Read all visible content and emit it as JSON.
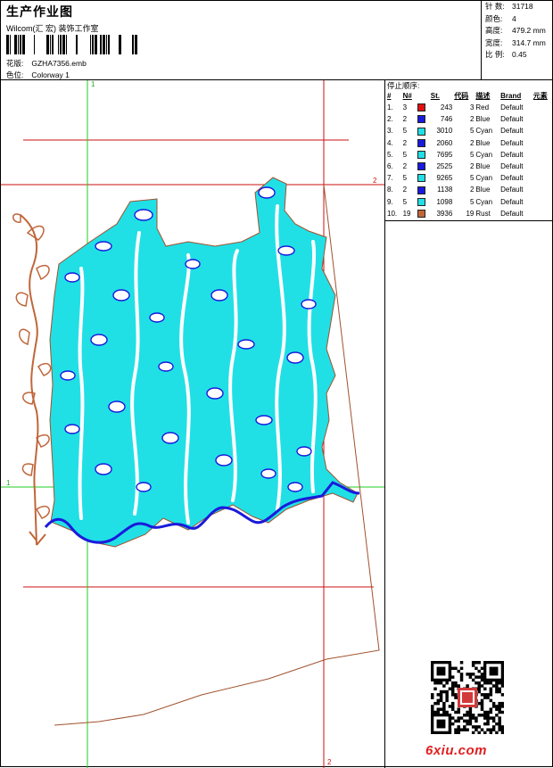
{
  "header": {
    "title": "生产作业图",
    "studio": "Wilcom(汇 宏) 装饰工作室",
    "design_label": "花版:",
    "design_value": "GZHA7356.emb",
    "colorway_label": "色位:",
    "colorway_value": "Colorway 1"
  },
  "stats": {
    "stitches_label": "针 数:",
    "stitches_value": "31718",
    "colors_label": "颜色:",
    "colors_value": "4",
    "height_label": "高度:",
    "height_value": "479.2 mm",
    "width_label": "宽度:",
    "width_value": "314.7 mm",
    "scale_label": "比 例:",
    "scale_value": "0.45"
  },
  "stop_sequence": {
    "title": "停止顺序:",
    "headers": [
      "#",
      "N#",
      "St.",
      "代码",
      "描述",
      "Brand",
      "元素"
    ],
    "rows": [
      {
        "idx": "1.",
        "n": "3",
        "color": "#e01010",
        "st": "243",
        "code": "3",
        "desc": "Red",
        "brand": "Default"
      },
      {
        "idx": "2.",
        "n": "2",
        "color": "#1a1adc",
        "st": "746",
        "code": "2",
        "desc": "Blue",
        "brand": "Default"
      },
      {
        "idx": "3.",
        "n": "5",
        "color": "#20e0e6",
        "st": "3010",
        "code": "5",
        "desc": "Cyan",
        "brand": "Default"
      },
      {
        "idx": "4.",
        "n": "2",
        "color": "#1a1adc",
        "st": "2060",
        "code": "2",
        "desc": "Blue",
        "brand": "Default"
      },
      {
        "idx": "5.",
        "n": "5",
        "color": "#20e0e6",
        "st": "7695",
        "code": "5",
        "desc": "Cyan",
        "brand": "Default"
      },
      {
        "idx": "6.",
        "n": "2",
        "color": "#1a1adc",
        "st": "2525",
        "code": "2",
        "desc": "Blue",
        "brand": "Default"
      },
      {
        "idx": "7.",
        "n": "5",
        "color": "#20e0e6",
        "st": "9265",
        "code": "5",
        "desc": "Cyan",
        "brand": "Default"
      },
      {
        "idx": "8.",
        "n": "2",
        "color": "#1a1adc",
        "st": "1138",
        "code": "2",
        "desc": "Blue",
        "brand": "Default"
      },
      {
        "idx": "9.",
        "n": "5",
        "color": "#20e0e6",
        "st": "1098",
        "code": "5",
        "desc": "Cyan",
        "brand": "Default"
      },
      {
        "idx": "10.",
        "n": "19",
        "color": "#c0663a",
        "st": "3936",
        "code": "19",
        "desc": "Rust",
        "brand": "Default"
      }
    ]
  },
  "guides": {
    "v1": "1",
    "v2": "2",
    "h1": "1",
    "h2": "2"
  },
  "colors": {
    "cyan": "#20e0e6",
    "blue": "#1a1adc",
    "rust": "#c0663a",
    "guide_green": "#22cc22",
    "guide_red": "#cc1111"
  },
  "watermark": "6xiu.com"
}
